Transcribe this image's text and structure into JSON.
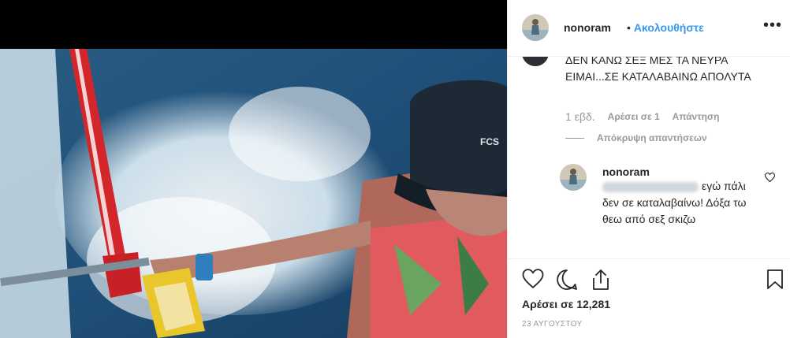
{
  "header": {
    "username": "nonoram",
    "separator": "•",
    "follow_label": "Ακολουθήστε",
    "more_icon": "more-horizontal-icon"
  },
  "comment": {
    "text": "ΔΕΝ ΚΑΝΩ ΣΕΞ ΜΕΣ ΤΑ ΝΕΥΡΑ ΕΙΜΑΙ...ΣΕ ΚΑΤΑΛΑΒΑΙΝΩ ΑΠΟΛΥΤΑ",
    "time": "1 εβδ.",
    "likes": "Αρέσει σε 1",
    "reply": "Απάντηση"
  },
  "hide_replies_label": "Απόκρυψη απαντήσεων",
  "reply": {
    "username": "nonoram",
    "text": "εγώ πάλι δεν σε καταλαβαίνω! Δόξα τω θεω από σεξ σκιζω"
  },
  "post": {
    "likes": "Αρέσει σε 12,281",
    "date": "23 ΑΥΓΟΥΣΤΟΥ"
  },
  "photo": {
    "cap_logo": "FCS"
  }
}
